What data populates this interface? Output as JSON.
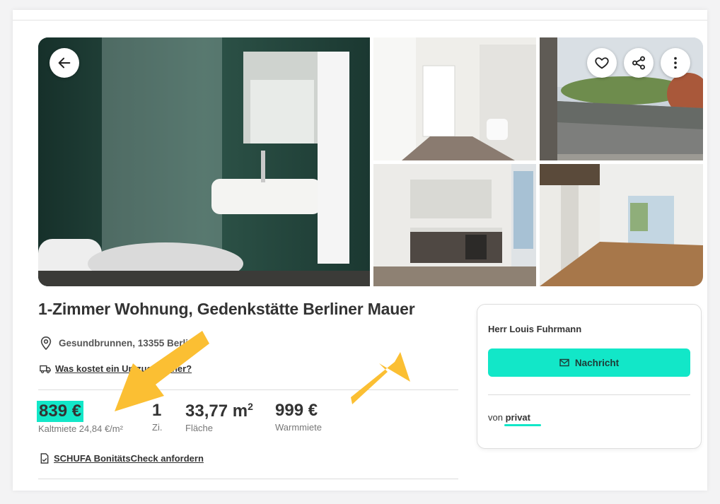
{
  "listing": {
    "title": "1-Zimmer Wohnung, Gedenkstätte Berliner Mauer",
    "location": "Gesundbrunnen, 13355 Berlin",
    "cost_link": "Was kostet ein Umzug hierher?",
    "price": {
      "value": "839 €",
      "label": "Kaltmiete 24,84 €/m²"
    },
    "rooms": {
      "value": "1",
      "label": "Zi."
    },
    "area": {
      "value": "33,77 m",
      "sup": "2",
      "label": "Fläche"
    },
    "warm": {
      "value": "999 €",
      "label": "Warmmiete"
    },
    "schufa_link": "SCHUFA BonitätsCheck anfordern"
  },
  "contact": {
    "name": "Herr Louis Fuhrmann",
    "message_button": "Nachricht",
    "from_prefix": "von",
    "from_value": "privat"
  },
  "icons": {
    "back": "arrow-left-icon",
    "favorite": "heart-icon",
    "share": "share-icon",
    "more": "more-vertical-icon",
    "location": "map-pin-icon",
    "moving": "truck-icon",
    "schufa": "document-icon",
    "message": "envelope-icon"
  },
  "colors": {
    "accent": "#12e7c8",
    "annotation_arrow": "#fbbf33",
    "text": "#333333"
  }
}
